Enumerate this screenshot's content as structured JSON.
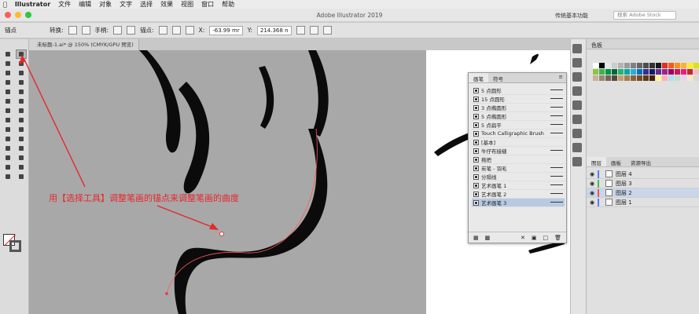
{
  "menubar": {
    "apple": "",
    "app": "Illustrator",
    "items": [
      "文件",
      "编辑",
      "对象",
      "文字",
      "选择",
      "效果",
      "视图",
      "窗口",
      "帮助"
    ]
  },
  "window": {
    "title": "Adobe Illustrator 2019",
    "workspace": "传统基本功能",
    "search_placeholder": "搜索 Adobe Stock"
  },
  "controlbar": {
    "mode_label": "锚点",
    "convert_label": "转换:",
    "handle_label": "手柄:",
    "anchor_label": "锚点:",
    "x_label": "X:",
    "x_value": "-63.99 mr",
    "y_label": "Y:",
    "y_value": "214.368 n"
  },
  "document": {
    "tab_label": "未标题-1.ai* @ 150% (CMYK/GPU 预览)"
  },
  "brush_panel": {
    "tabs": [
      "画笔",
      "符号"
    ],
    "menu_icon": "panel-menu-icon",
    "brushes": [
      {
        "label": "5 点圆形",
        "selected": false
      },
      {
        "label": "15 点圆形",
        "selected": false
      },
      {
        "label": "3 点椭圆形",
        "selected": false
      },
      {
        "label": "5 点椭圆形",
        "selected": false
      },
      {
        "label": "5 点扁平",
        "selected": false
      },
      {
        "label": "Touch Calligraphic Brush",
        "selected": false
      },
      {
        "label": "[基本]",
        "selected": false
      },
      {
        "label": "牛仔布接缝",
        "selected": false
      },
      {
        "label": "拖把",
        "selected": false
      },
      {
        "label": "炭笔 - 羽毛",
        "selected": false
      },
      {
        "label": "分隔线",
        "selected": false
      },
      {
        "label": "艺术画笔 1",
        "selected": false
      },
      {
        "label": "艺术画笔 2",
        "selected": false
      },
      {
        "label": "艺术画笔 3",
        "selected": true
      }
    ]
  },
  "swatches_panel": {
    "title": "色板",
    "colors": [
      "#ffffff",
      "#000000",
      "#e6e6e6",
      "#cccccc",
      "#b3b3b3",
      "#999999",
      "#808080",
      "#666666",
      "#4d4d4d",
      "#333333",
      "#1a1a1a",
      "#e0301e",
      "#f15a24",
      "#f7931e",
      "#fbb03b",
      "#fcee21",
      "#d9e021",
      "#8cc63f",
      "#39b54a",
      "#009245",
      "#006837",
      "#22b573",
      "#00a99d",
      "#29abe2",
      "#0071bc",
      "#2e3192",
      "#1b1464",
      "#662d91",
      "#93278f",
      "#9e005d",
      "#d4145a",
      "#ed1e79",
      "#c1272d",
      "#f7bdb8",
      "#c7b299",
      "#998675",
      "#736357",
      "#534741",
      "#c69c6d",
      "#a67c52",
      "#8c6239",
      "#754c24",
      "#603813",
      "#42210b",
      "#fff799",
      "#fcb0b6",
      "#b3dcf4",
      "#bfe2c8",
      "#e6d4f2",
      "#ffe5c2",
      "#d9d9d9"
    ]
  },
  "layers_panel": {
    "tabs": [
      "图层",
      "画板",
      "资源导出"
    ],
    "layers": [
      {
        "name": "图层 4",
        "color": "#4f7fff",
        "selected": false
      },
      {
        "name": "图层 3",
        "color": "#3fbf3f",
        "selected": false
      },
      {
        "name": "图层 2",
        "color": "#ff4f4f",
        "selected": true
      },
      {
        "name": "图层 1",
        "color": "#4f7fff",
        "selected": false
      }
    ]
  },
  "annotation": {
    "text": "用【选择工具】调整笔画的锚点来调整笔画的曲度",
    "color": "#e8262b"
  }
}
